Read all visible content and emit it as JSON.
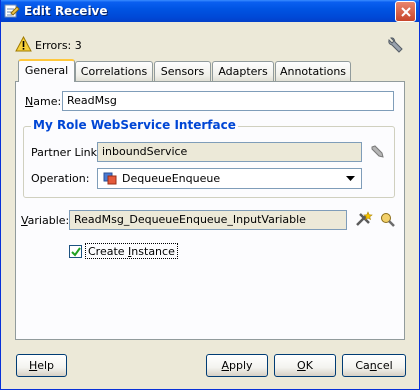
{
  "window": {
    "title": "Edit Receive",
    "close_icon": "close-icon"
  },
  "status": {
    "errors_text": "Errors: 3",
    "icon": "warning-icon"
  },
  "tabs": [
    {
      "label": "General",
      "active": true
    },
    {
      "label": "Correlations"
    },
    {
      "label": "Sensors"
    },
    {
      "label": "Adapters"
    },
    {
      "label": "Annotations"
    }
  ],
  "general": {
    "name_label_mnemonic": "N",
    "name_label_rest": "ame:",
    "name_value": "ReadMsg",
    "group_title": "My Role WebService Interface",
    "partner_link_label": "Partner Link:",
    "partner_link_value": "inboundService",
    "operation_label": "Operation:",
    "operation_value": "DequeueEnqueue",
    "variable_label_mnemonic": "V",
    "variable_label_rest": "ariable:",
    "variable_value": "ReadMsg_DequeueEnqueue_InputVariable",
    "create_instance_pre": "Create ",
    "create_instance_mnemonic": "I",
    "create_instance_post": "nstance",
    "create_instance_checked": true
  },
  "buttons": {
    "help_mnemonic": "H",
    "help_rest": "elp",
    "apply_mnemonic": "A",
    "apply_rest": "pply",
    "ok_mnemonic": "O",
    "ok_rest": "K",
    "cancel_pre": "Ca",
    "cancel_mnemonic": "n",
    "cancel_post": "cel"
  },
  "colors": {
    "title_bar": "#0054e3",
    "group_title": "#0046d5",
    "active_tab_accent": "#ffc83c"
  }
}
